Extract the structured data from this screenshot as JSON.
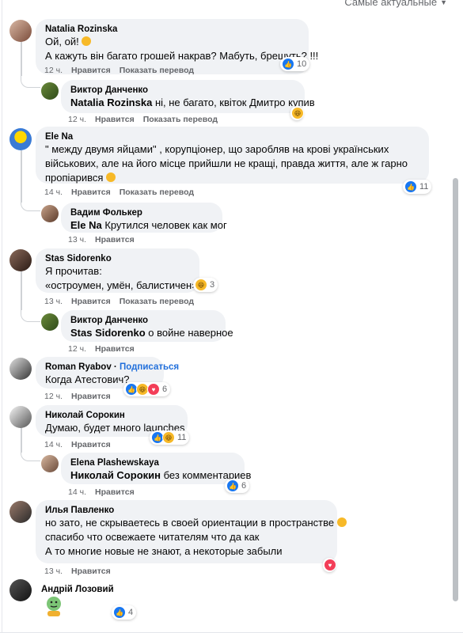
{
  "sort_label": "Самые актуальные",
  "actions": {
    "like": "Нравится",
    "translate": "Показать перевод"
  },
  "comments": [
    {
      "author": "Natalia Rozinska",
      "lines": [
        "Ой, ой! ",
        "А кажуть він багато грошей накрав? Мабуть, брешуть? !!!"
      ],
      "time": "12 ч.",
      "reactions": "10"
    },
    {
      "author": "Виктор Данченко",
      "mention": "Natalia Rozinska",
      "text": " ні, не багато, квіток Дмитро купив",
      "time": "12 ч."
    },
    {
      "author": "Ele Na",
      "lines": [
        "\" между двумя яйцами\" , корупціонер, що заробляв на крові українських",
        "військових, але на його місце прийшли не кращі, правда життя, але ж гарно",
        "пропіарився "
      ],
      "time": "14 ч.",
      "reactions": "11"
    },
    {
      "author": "Вадим Фолькер",
      "mention": "Ele Na",
      "text": " Крутился человек как мог",
      "time": "13 ч."
    },
    {
      "author": "Stas Sidorenko",
      "lines": [
        "Я прочитав:",
        "«остроумен, умён, балистичен»..."
      ],
      "time": "13 ч.",
      "reactions": "3"
    },
    {
      "author": "Виктор Данченко",
      "mention": "Stas Sidorenko",
      "text": " о войне наверное",
      "time": "12 ч."
    },
    {
      "author": "Roman Ryabov",
      "subscribe": "Подписаться",
      "lines": [
        "Когда Атестович?"
      ],
      "time": "12 ч.",
      "reactions": "6"
    },
    {
      "author": "Николай Сорокин",
      "lines": [
        "Думаю, будет много launches"
      ],
      "time": "14 ч.",
      "reactions": "11"
    },
    {
      "author": "Elena Plashewskaya",
      "mention": "Николай Сорокин",
      "text": " без комментариев",
      "time": "14 ч.",
      "reactions": "6"
    },
    {
      "author": "Илья Павленко",
      "lines": [
        "но зато, не скрываетесь в своей ориентации в пространстве ",
        "спасибо что освежаете читателям что да как",
        "А то многие новые не знают, а некоторые забыли"
      ],
      "time": "13 ч."
    },
    {
      "author": "Андрій Лозовий",
      "reactions": "4"
    }
  ],
  "colors": {
    "like": "#1877f2",
    "love": "#f33e58",
    "haha": "#f7b928",
    "bubble": "#f0f2f5",
    "meta": "#65676b"
  }
}
